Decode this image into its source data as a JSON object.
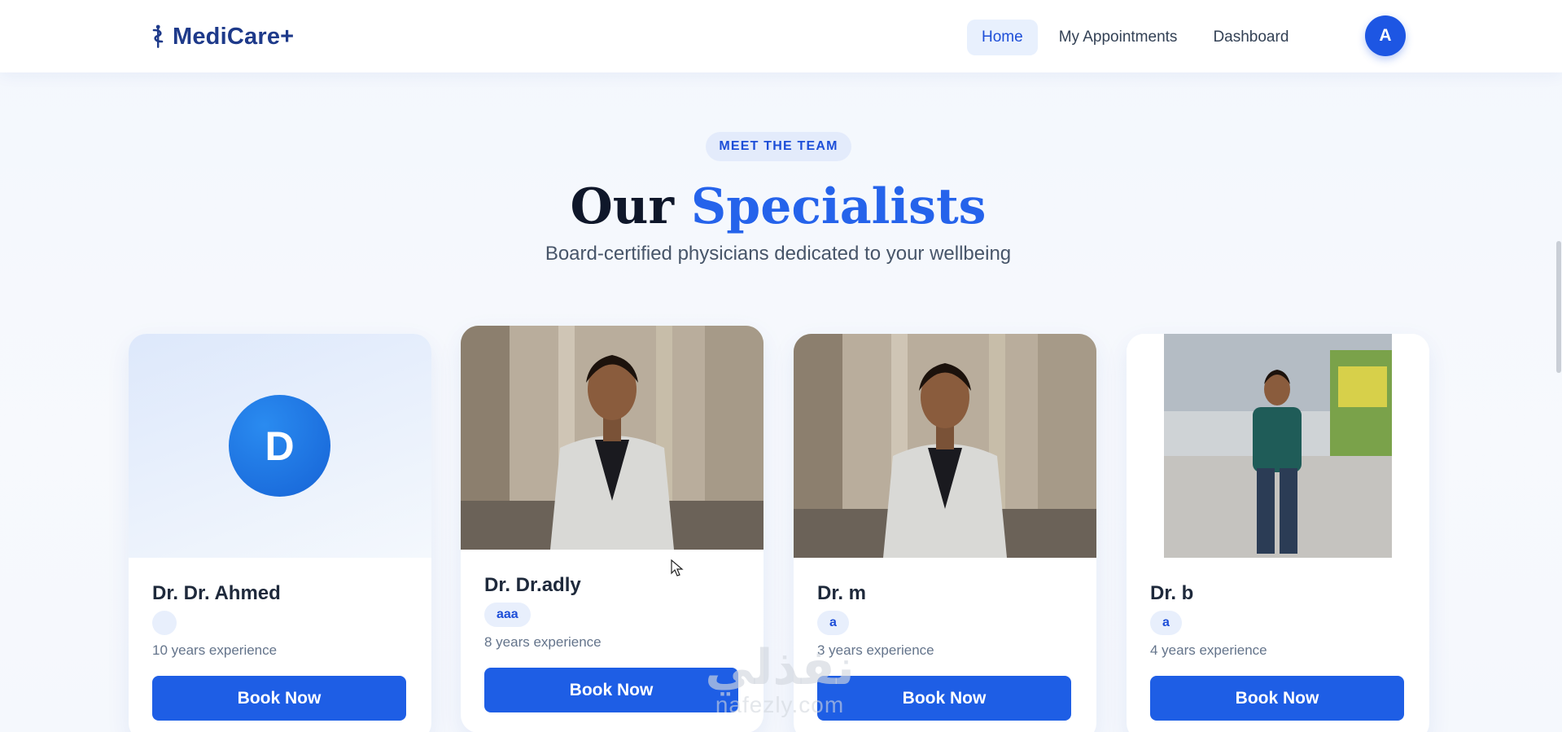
{
  "nav": {
    "brand": "MediCare+",
    "links": [
      "Home",
      "My Appointments",
      "Dashboard"
    ],
    "active_link": "Home",
    "avatar_initial": "A",
    "logo_icon": "caduceus-icon"
  },
  "hero": {
    "eyebrow": "MEET THE TEAM",
    "title_main": "Our",
    "title_accent": "Specialists",
    "subtitle": "Board-certified physicians dedicated to your wellbeing"
  },
  "doctors": [
    {
      "name": "Dr. Dr. Ahmed",
      "specialty": "",
      "experience": "10 years experience",
      "initial": "D",
      "button": "Book Now"
    },
    {
      "name": "Dr. Dr.adly",
      "specialty": "aaa",
      "experience": "8 years experience",
      "button": "Book Now"
    },
    {
      "name": "Dr. m",
      "specialty": "a",
      "experience": "3 years experience",
      "button": "Book Now"
    },
    {
      "name": "Dr. b",
      "specialty": "a",
      "experience": "4 years experience",
      "button": "Book Now"
    }
  ],
  "watermark": {
    "arabic": "نفذلي",
    "latin": "nafezly.com"
  },
  "colors": {
    "primary": "#1e5ee5",
    "accent": "#2563eb",
    "brand": "#1e3a8a",
    "chip_bg": "#e8effc"
  }
}
